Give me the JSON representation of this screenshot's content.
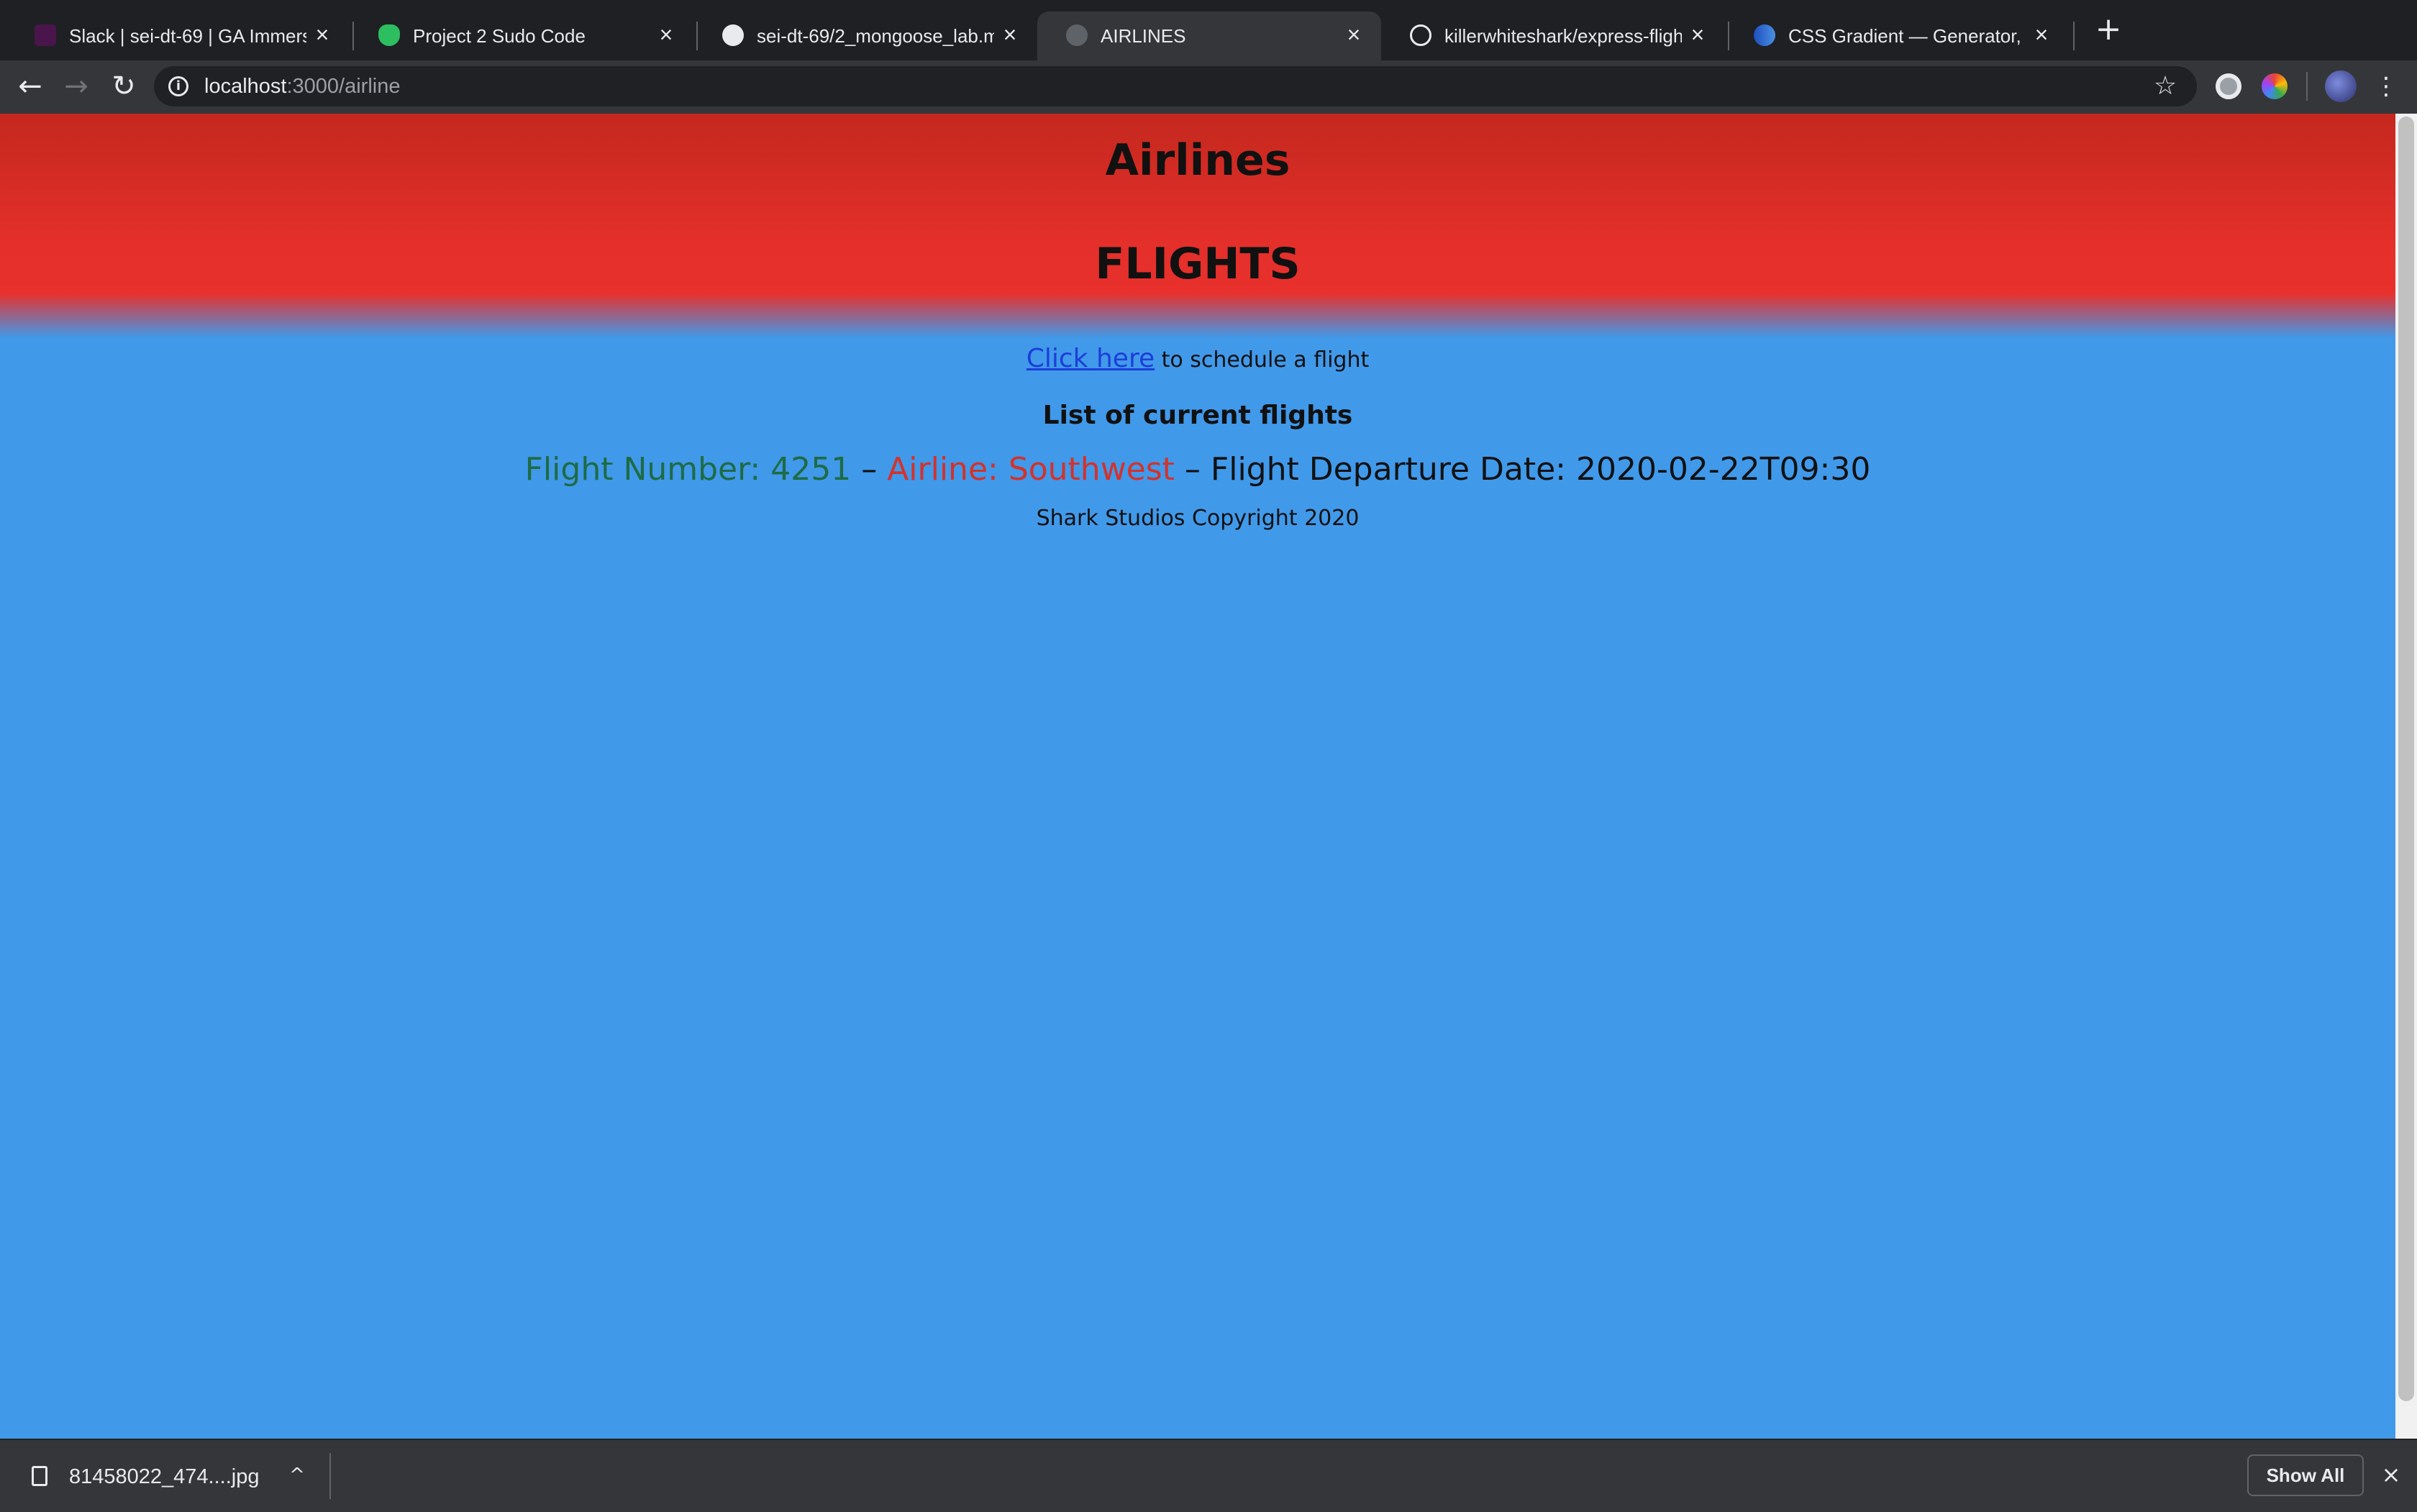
{
  "browser": {
    "tabs": [
      {
        "title": "Slack | sei-dt-69 | GA Immersive",
        "favicon": "slack-icon",
        "color": "#4a154b"
      },
      {
        "title": "Project 2 Sudo Code",
        "favicon": "evernote-icon",
        "color": "#2dbe60"
      },
      {
        "title": "sei-dt-69/2_mongoose_lab.md",
        "favicon": "github-icon",
        "color": "#e8eaed"
      },
      {
        "title": "AIRLINES",
        "favicon": "globe-icon",
        "color": "#5f6368"
      },
      {
        "title": "killerwhiteshark/express-flights",
        "favicon": "github-icon",
        "color": "#1f2023"
      },
      {
        "title": "CSS Gradient — Generator, Maker",
        "favicon": "globe-icon",
        "color": "#2a6fdb"
      }
    ],
    "active_tab": 3,
    "url": {
      "host": "localhost",
      "path": ":3000/airline"
    }
  },
  "page": {
    "site_title": "Airlines",
    "heading": "FLIGHTS",
    "schedule_link": "Click here",
    "schedule_text": " to schedule a flight",
    "list_heading": "List of current flights",
    "flights": [
      {
        "number_text": "Flight Number: 4251",
        "airline_text": "Airline: Southwest",
        "date_text": "Flight Departure Date: 2020-02-22T09:30"
      }
    ],
    "footer": "Shark Studios Copyright 2020"
  },
  "downloads": {
    "file_name": "81458022_474....jpg",
    "show_all": "Show All"
  },
  "colors": {
    "header_red": "#e32f2a",
    "page_blue": "#4199ea",
    "flight_number_green": "#1e6b45",
    "airline_red": "#d3322b"
  }
}
